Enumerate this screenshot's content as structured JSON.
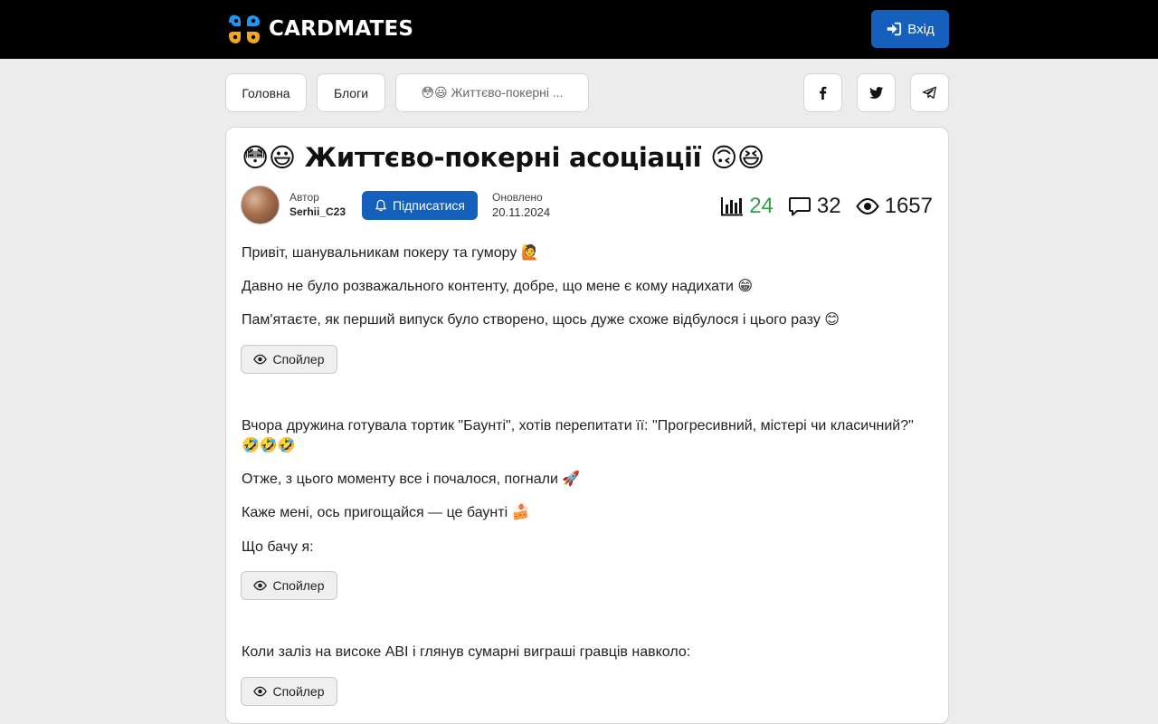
{
  "header": {
    "logo_text": "CARDMATES",
    "login_label": "Вхід",
    "brand_colors": {
      "blue": "#2196f3",
      "orange": "#f5a623",
      "button": "#1560bd"
    }
  },
  "breadcrumbs": [
    {
      "label": "Головна"
    },
    {
      "label": "Блоги"
    },
    {
      "label": "😳😃 Життєво-покерні ..."
    }
  ],
  "share": [
    {
      "icon": "facebook-icon"
    },
    {
      "icon": "twitter-icon"
    },
    {
      "icon": "telegram-icon"
    }
  ],
  "post": {
    "title": "😳😃 Життєво-покерні асоціації 🙃😆",
    "author_label": "Автор",
    "author_name": "Serhii_C23",
    "subscribe_label": "Підписатися",
    "updated_label": "Оновлено",
    "updated_date": "20.11.2024",
    "stats": {
      "rating": "24",
      "comments": "32",
      "views": "1657"
    },
    "paragraphs": [
      "Привіт, шанувальникам покеру та гумору 🙋",
      "Давно не було розважального контенту, добре, що мене є кому надихати 😁",
      "Пам'ятаєте, як перший випуск було створено, щось дуже схоже відбулося і цього разу 😊",
      "Вчора дружина готувала тортик \"Баунті\", хотів перепитати її: \"Прогресивний, містері чи класичний?\" 🤣🤣🤣",
      "Отже, з цього моменту все і почалося, погнали 🚀",
      "Каже мені, ось пригощайся — це баунті 🍰",
      "Що бачу я:",
      "Коли заліз на високе ABI і глянув сумарні виграші гравців навколо:"
    ],
    "spoiler_label": "Спойлер"
  }
}
